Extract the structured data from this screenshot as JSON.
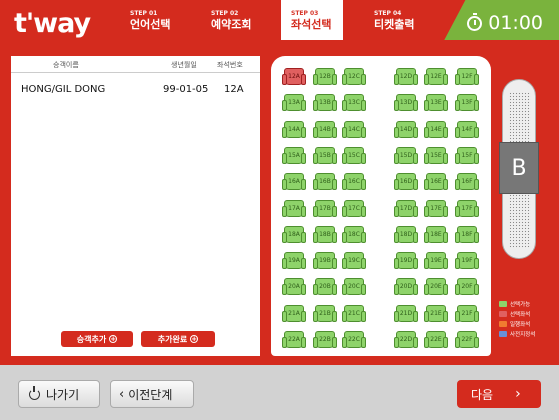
{
  "header": {
    "logo": "t'way",
    "steps": [
      {
        "num": "STEP 01",
        "label": "언어선택"
      },
      {
        "num": "STEP 02",
        "label": "예약조회"
      },
      {
        "num": "STEP 03",
        "label": "좌석선택"
      },
      {
        "num": "STEP 04",
        "label": "티켓출력"
      }
    ],
    "active_step": 2,
    "timer": "01:00"
  },
  "passengers": {
    "columns": [
      "승객이름",
      "생년월일",
      "좌석번호"
    ],
    "rows": [
      {
        "name": "HONG/GIL DONG",
        "birth": "99-01-05",
        "seat": "12A"
      }
    ],
    "add_passenger_label": "승객추가",
    "add_done_label": "추가완료"
  },
  "seatmap": {
    "rows": [
      "12",
      "13",
      "14",
      "15",
      "16",
      "17",
      "18",
      "19",
      "20",
      "21",
      "22"
    ],
    "left_cols": [
      "A",
      "B",
      "C"
    ],
    "right_cols": [
      "D",
      "E",
      "F"
    ],
    "selected_seat": "12A",
    "zone": "B"
  },
  "legend": [
    {
      "label": "선택가능",
      "color": "#8ed36a"
    },
    {
      "label": "선택좌석",
      "color": "#e06060"
    },
    {
      "label": "일행좌석",
      "color": "#f07a30"
    },
    {
      "label": "사전지정석",
      "color": "#6a8fd6"
    }
  ],
  "footer": {
    "exit_label": "나가기",
    "prev_label": "이전단계",
    "next_label": "다음"
  },
  "colors": {
    "brand": "#d42b1e",
    "timer_bg": "#7ab33d",
    "seat_available": "#8ed36a",
    "seat_selected": "#e06060"
  }
}
